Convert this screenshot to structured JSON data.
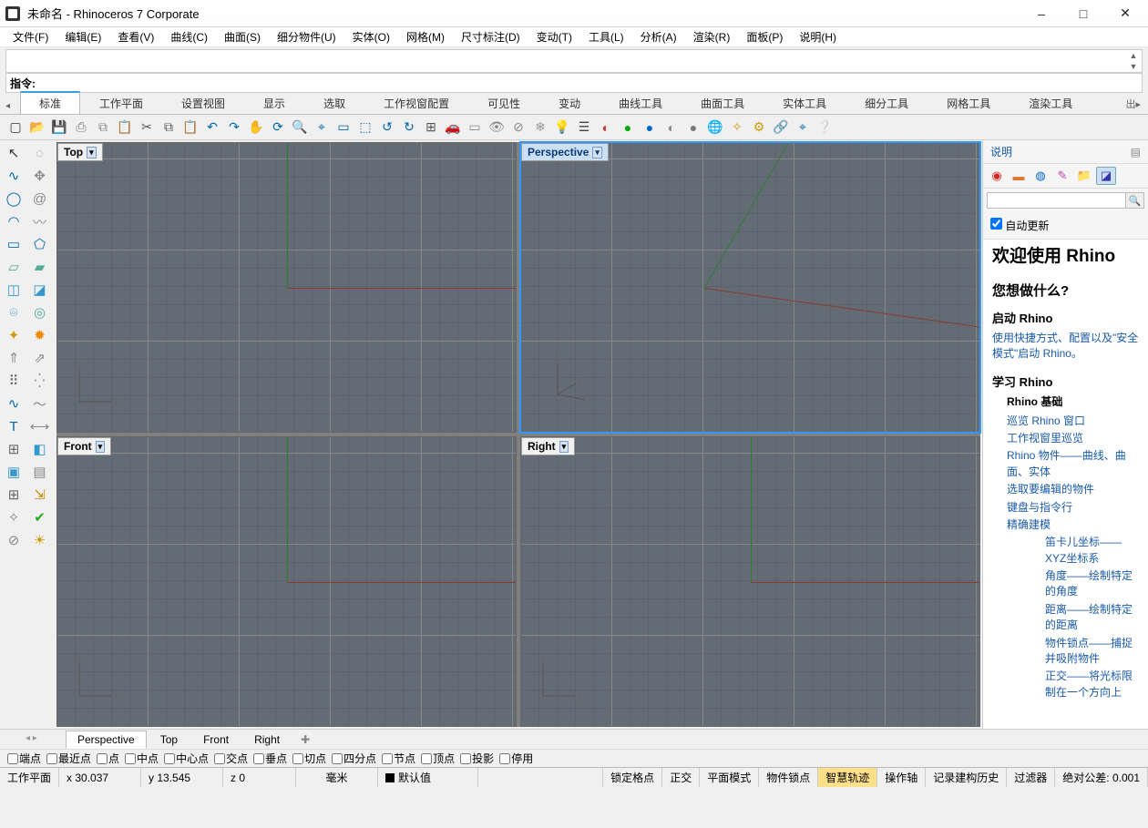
{
  "title": "未命名 - Rhinoceros 7 Corporate",
  "menu": [
    "文件(F)",
    "编辑(E)",
    "查看(V)",
    "曲线(C)",
    "曲面(S)",
    "细分物件(U)",
    "实体(O)",
    "网格(M)",
    "尺寸标注(D)",
    "变动(T)",
    "工具(L)",
    "分析(A)",
    "渲染(R)",
    "面板(P)",
    "说明(H)"
  ],
  "command_label": "指令:",
  "tabs": [
    "标准",
    "工作平面",
    "设置视图",
    "显示",
    "选取",
    "工作视窗配置",
    "可见性",
    "变动",
    "曲线工具",
    "曲面工具",
    "实体工具",
    "细分工具",
    "网格工具",
    "渲染工具"
  ],
  "active_tab": 0,
  "viewport": {
    "top": "Top",
    "perspective": "Perspective",
    "front": "Front",
    "right": "Right",
    "active": "Perspective"
  },
  "vp_tabs": [
    "Perspective",
    "Top",
    "Front",
    "Right"
  ],
  "active_vp_tab": 0,
  "osnaps": [
    "端点",
    "最近点",
    "点",
    "中点",
    "中心点",
    "交点",
    "垂点",
    "切点",
    "四分点",
    "节点",
    "顶点",
    "投影",
    "停用"
  ],
  "right_panel": {
    "title": "说明",
    "auto_update": "自动更新",
    "welcome": "欢迎使用 Rhino",
    "question": "您想做什么?",
    "sec1": "启动 Rhino",
    "link1": "使用快捷方式、配置以及\"安全模式\"启动 Rhino。",
    "sec2": "学习 Rhino",
    "basics_head": "Rhino 基础",
    "links2": [
      "巡览 Rhino 窗口",
      "工作视窗里巡览",
      "Rhino 物件——曲线、曲面、实体",
      "选取要编辑的物件",
      "键盘与指令行",
      "精确建模"
    ],
    "links3": [
      "笛卡儿坐标——XYZ坐标系",
      "角度——绘制特定的角度",
      "距离——绘制特定的距离",
      "物件锁点——捕捉并吸附物件",
      "正交——将光标限制在一个方向上"
    ]
  },
  "status": {
    "cplane": "工作平面",
    "x": "x 30.037",
    "y": "y 13.545",
    "z": "z 0",
    "units": "毫米",
    "layer": "默认值",
    "toggles": [
      "锁定格点",
      "正交",
      "平面模式",
      "物件锁点",
      "智慧轨迹",
      "操作轴",
      "记录建构历史",
      "过滤器"
    ],
    "hl_toggle": 4,
    "tol": "绝对公差: 0.001"
  }
}
